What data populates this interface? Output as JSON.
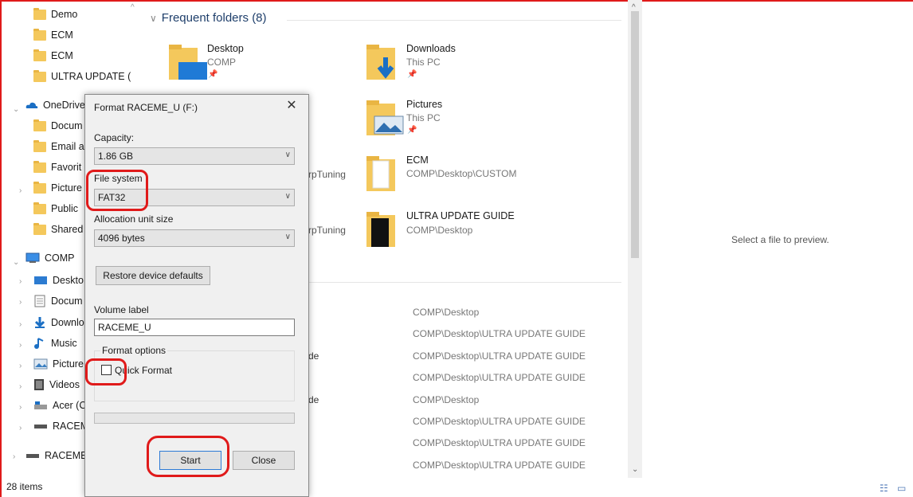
{
  "nav": {
    "items": [
      {
        "label": "Demo",
        "icon": "folder-icon"
      },
      {
        "label": "ECM",
        "icon": "folder-icon"
      },
      {
        "label": "ECM",
        "icon": "folder-icon"
      },
      {
        "label": "ULTRA UPDATE (",
        "icon": "folder-icon"
      },
      {
        "label": "OneDrive",
        "icon": "onedrive-icon"
      },
      {
        "label": "Docum",
        "icon": "folder-icon"
      },
      {
        "label": "Email a",
        "icon": "folder-icon"
      },
      {
        "label": "Favorit",
        "icon": "folder-icon"
      },
      {
        "label": "Picture",
        "icon": "folder-icon"
      },
      {
        "label": "Public",
        "icon": "folder-icon"
      },
      {
        "label": "Shared",
        "icon": "folder-icon"
      },
      {
        "label": "COMP",
        "icon": "computer-icon"
      },
      {
        "label": "Deskto",
        "icon": "desktop-icon"
      },
      {
        "label": "Docum",
        "icon": "documents-icon"
      },
      {
        "label": "Downlo",
        "icon": "downloads-icon"
      },
      {
        "label": "Music",
        "icon": "music-icon"
      },
      {
        "label": "Picture",
        "icon": "pictures-icon"
      },
      {
        "label": "Videos",
        "icon": "videos-icon"
      },
      {
        "label": "Acer (C",
        "icon": "drive-icon"
      },
      {
        "label": "RACEM",
        "icon": "usb-drive-icon"
      },
      {
        "label": "RACEME",
        "icon": "usb-drive-icon"
      }
    ]
  },
  "frequent": {
    "header": "Frequent folders (8)",
    "tiles": [
      {
        "name": "Desktop",
        "sub": "COMP"
      },
      {
        "name": "Downloads",
        "sub": "This PC"
      },
      {
        "name": "Pictures",
        "sub": "This PC"
      },
      {
        "name": "ECM",
        "sub": "COMP\\Desktop\\CUSTOM"
      },
      {
        "name": "ULTRA UPDATE GUIDE",
        "sub": "COMP\\Desktop"
      }
    ],
    "partial": [
      "rpTuning",
      "rpTuning"
    ]
  },
  "recent": {
    "paths": [
      "COMP\\Desktop",
      "COMP\\Desktop\\ULTRA UPDATE GUIDE",
      "COMP\\Desktop\\ULTRA UPDATE GUIDE",
      "COMP\\Desktop\\ULTRA UPDATE GUIDE",
      "COMP\\Desktop",
      "COMP\\Desktop\\ULTRA UPDATE GUIDE",
      "COMP\\Desktop\\ULTRA UPDATE GUIDE",
      "COMP\\Desktop\\ULTRA UPDATE GUIDE"
    ],
    "partial": [
      "de",
      "de"
    ]
  },
  "preview": {
    "text": "Select a file to preview."
  },
  "status": {
    "items": "28 items"
  },
  "dialog": {
    "title": "Format RACEME_U (F:)",
    "close": "✕",
    "capacity_label": "Capacity:",
    "capacity_value": "1.86 GB",
    "filesystem_label": "File system",
    "filesystem_value": "FAT32",
    "alloc_label": "Allocation unit size",
    "alloc_value": "4096 bytes",
    "restore_button": "Restore device defaults",
    "volume_label": "Volume label",
    "volume_value": "RACEME_U",
    "format_options": "Format options",
    "quick_format": "Quick Format",
    "start_button": "Start",
    "close_button": "Close"
  },
  "colors": {
    "highlight": "#e01a1a",
    "accent": "#1f3f6b"
  }
}
